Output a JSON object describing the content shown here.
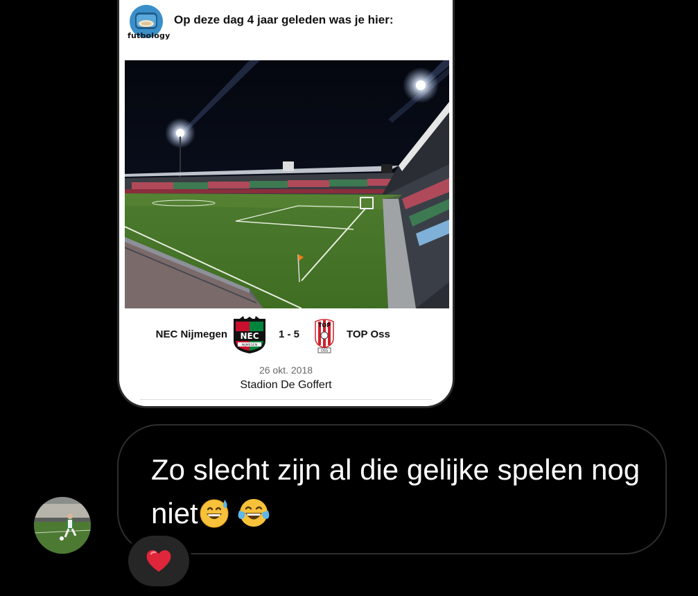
{
  "shared_post": {
    "brand_name": "futbology",
    "memory_text": "Op deze dag 4 jaar geleden was je hier:",
    "match": {
      "home_team": "NEC Nijmegen",
      "home_crest_text": "NEC",
      "home_crest_sub": "NIJMEGEN",
      "score": "1 - 5",
      "away_team": "TOP Oss",
      "away_crest_text": "TOP",
      "away_crest_sub": "OSS"
    },
    "date": "26 okt. 2018",
    "venue": "Stadion De Goffert"
  },
  "message": {
    "text": "Zo slecht zijn al die gelijke spelen nog niet",
    "emojis": [
      "grinning-sweat-emoji",
      "tears-of-joy-emoji"
    ]
  },
  "reaction": {
    "emoji": "red-heart-emoji"
  },
  "colors": {
    "background": "#000000",
    "bubble_border": "#2e2e2e",
    "reaction_pill": "#262626",
    "heart": "#e0263a",
    "nec_red": "#c8102e",
    "nec_green": "#00843d",
    "top_red": "#d21f2a"
  }
}
